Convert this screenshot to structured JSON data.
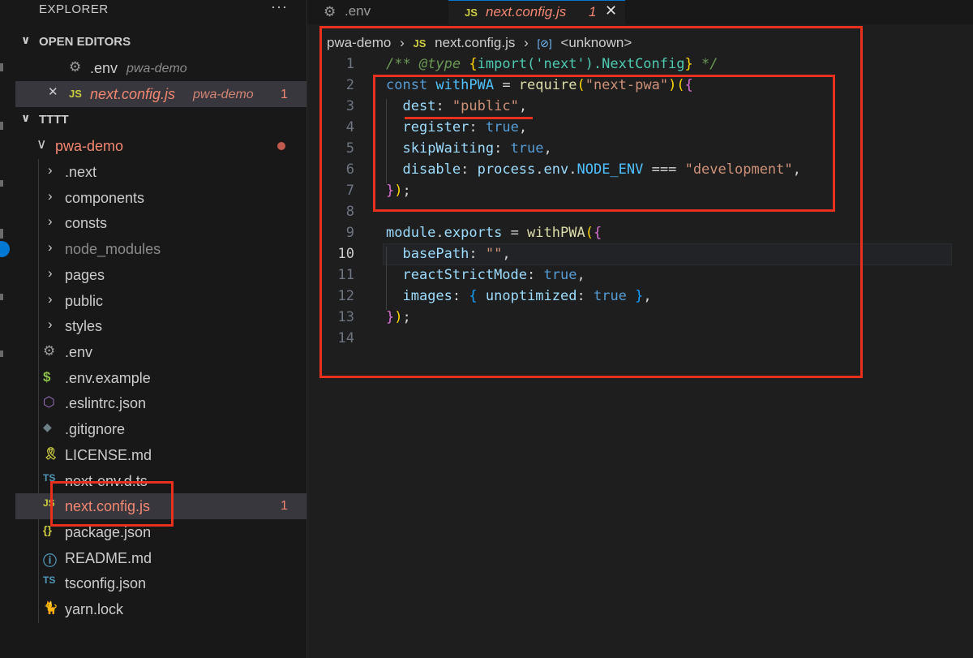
{
  "sidebar": {
    "title": "EXPLORER",
    "more": "···",
    "open_editors": {
      "label": "OPEN EDITORS",
      "items": [
        {
          "icon": "⚙",
          "name": ".env",
          "desc": "pwa-demo",
          "count": ""
        },
        {
          "icon": "JS",
          "name": "next.config.js",
          "desc": "pwa-demo",
          "count": "1"
        }
      ]
    },
    "workspace": {
      "label": "TTTT",
      "folder": "pwa-demo",
      "folders": [
        ".next",
        "components",
        "consts",
        "node_modules",
        "pages",
        "public",
        "styles"
      ],
      "files": [
        {
          "icon": "⚙",
          "name": ".env"
        },
        {
          "icon": "$",
          "name": ".env.example"
        },
        {
          "icon": "⬡",
          "name": ".eslintrc.json"
        },
        {
          "icon": "◆",
          "name": ".gitignore"
        },
        {
          "icon": "🎗",
          "name": "LICENSE.md"
        },
        {
          "icon": "TS",
          "name": "next-env.d.ts"
        },
        {
          "icon": "JS",
          "name": "next.config.js",
          "count": "1"
        },
        {
          "icon": "{}",
          "name": "package.json"
        },
        {
          "icon": "ⓘ",
          "name": "README.md"
        },
        {
          "icon": "TS",
          "name": "tsconfig.json"
        },
        {
          "icon": "🐈",
          "name": "yarn.lock"
        }
      ]
    }
  },
  "tabs": [
    {
      "icon": "⚙",
      "label": ".env"
    },
    {
      "icon": "JS",
      "label": "next.config.js",
      "count": "1",
      "close": "✕"
    }
  ],
  "breadcrumb": {
    "folder": "pwa-demo",
    "sep": "›",
    "file_icon": "JS",
    "file": "next.config.js",
    "symbol_icon": "[⊘]",
    "symbol": "<unknown>"
  },
  "editor": {
    "line_numbers": [
      "1",
      "2",
      "3",
      "4",
      "5",
      "6",
      "7",
      "8",
      "9",
      "10",
      "11",
      "12",
      "13",
      "14"
    ],
    "colors": {
      "error": "#f48771",
      "js_icon": "#cbcb41",
      "annotation": "#e8301c"
    }
  }
}
